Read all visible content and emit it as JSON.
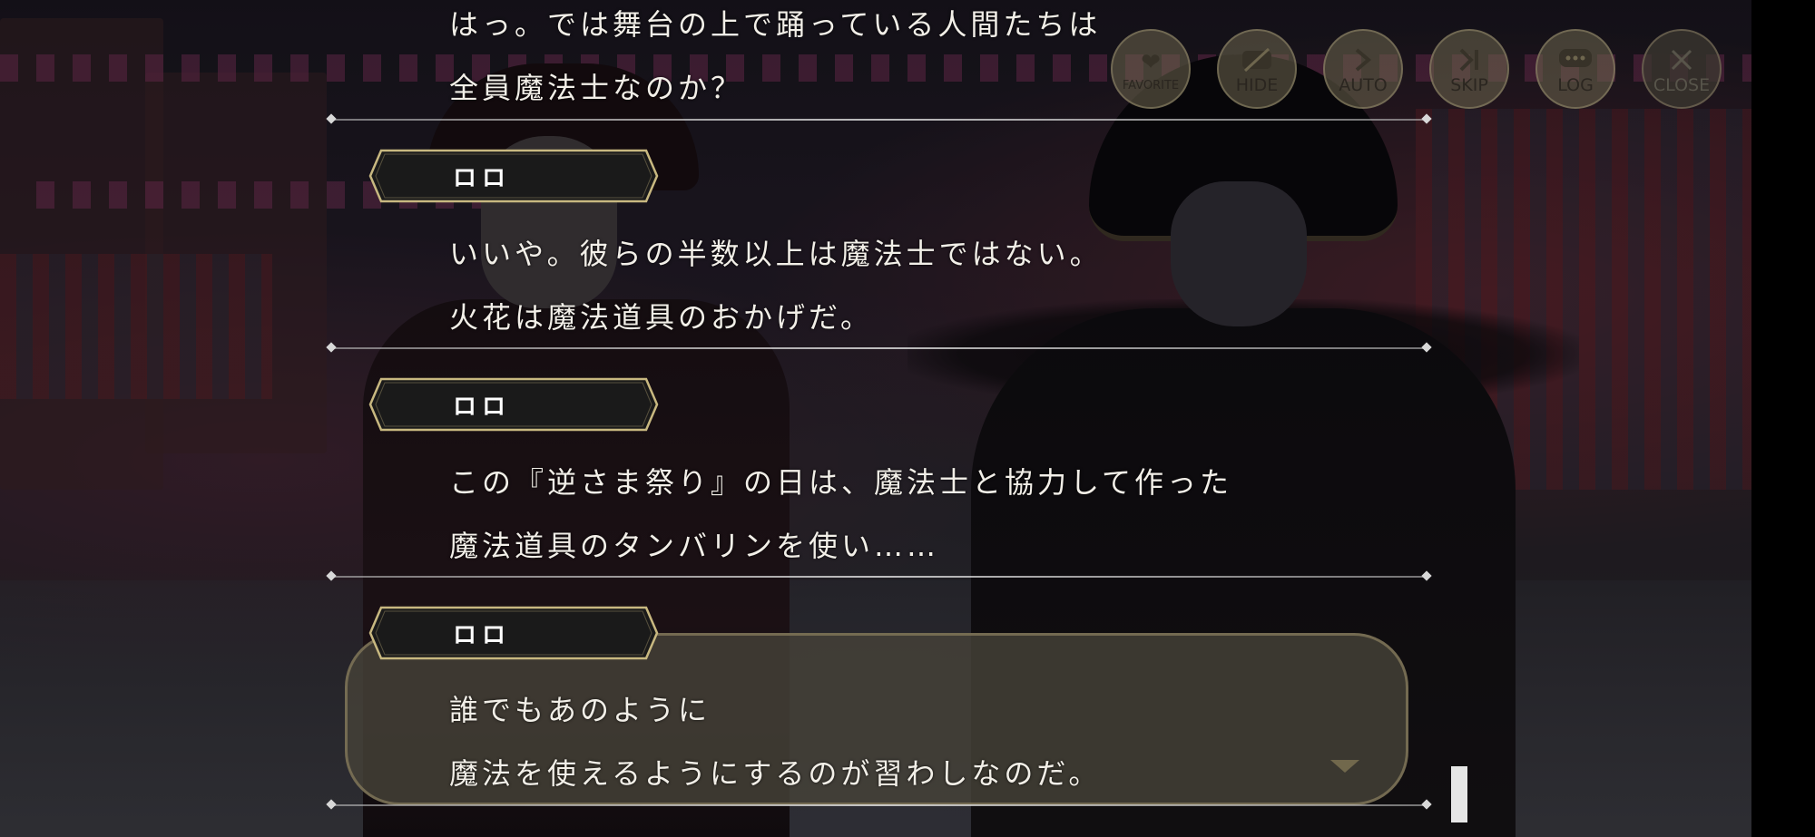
{
  "controls": {
    "favorite": {
      "label": "FAVORITE",
      "icon": "heart-icon"
    },
    "hide": {
      "label": "HIDE",
      "icon": "hide-icon"
    },
    "auto": {
      "label": "AUTO",
      "icon": "chevron-right-icon"
    },
    "skip": {
      "label": "SKIP",
      "icon": "skip-icon"
    },
    "log": {
      "label": "LOG",
      "icon": "chat-bubble-icon"
    },
    "close": {
      "label": "CLOSE",
      "icon": "close-icon"
    }
  },
  "log": {
    "entry1": {
      "line1": "はっ。では舞台の上で踊っている人間たちは",
      "line2": "全員魔法士なのか？"
    },
    "entry2": {
      "speaker": "ロロ",
      "line1": "いいや。彼らの半数以上は魔法士ではない。",
      "line2": "火花は魔法道具のおかげだ。"
    },
    "entry3": {
      "speaker": "ロロ",
      "line1": "この『逆さま祭り』の日は、魔法士と協力して作った",
      "line2": "魔法道具のタンバリンを使い……"
    },
    "entry4": {
      "speaker": "ロロ",
      "line1": "誰でもあのように",
      "line2": "魔法を使えるようにするのが習わしなのだ。"
    }
  },
  "colors": {
    "text": "#f2efe8",
    "nameplate_fill": "#1a1a1a",
    "nameplate_border": "#c8b880",
    "current_box": "#464238"
  }
}
